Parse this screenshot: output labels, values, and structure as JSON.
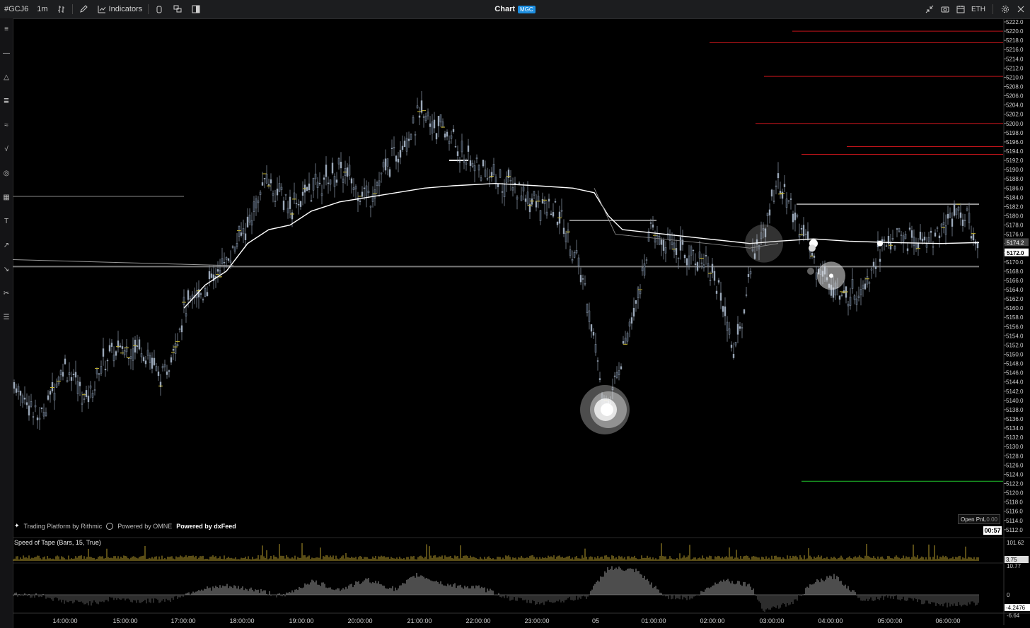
{
  "toolbar": {
    "symbol": "#GCJ6",
    "interval": "1m",
    "indicators_label": "Indicators",
    "title": "Chart",
    "badge": "MGC",
    "session": "ETH"
  },
  "icons": {
    "draw": "pencil-icon",
    "compare": "compare-icon",
    "lock": "lock-icon",
    "layout": "layout-icon",
    "panel": "panel-icon",
    "collapse": "collapse-icon",
    "camera": "camera-icon",
    "calendar": "calendar-icon",
    "settings": "gear-icon",
    "close": "close-icon"
  },
  "sidebar_tools": [
    "menu-icon",
    "line-icon",
    "triangle-icon",
    "fib-icon",
    "pattern-icon",
    "curve-icon",
    "target-icon",
    "grid-icon",
    "text-icon",
    "long-icon",
    "short-icon",
    "ruler-icon",
    "list-icon"
  ],
  "price_axis": {
    "labels": [
      "5222.0",
      "5220.0",
      "5218.0",
      "5216.0",
      "5214.0",
      "5212.0",
      "5210.0",
      "5208.0",
      "5206.0",
      "5204.0",
      "5202.0",
      "5200.0",
      "5198.0",
      "5196.0",
      "5194.0",
      "5192.0",
      "5190.0",
      "5188.0",
      "5186.0",
      "5184.0",
      "5182.0",
      "5180.0",
      "5178.0",
      "5176.0",
      "5174.0",
      "5172.0",
      "5170.0",
      "5168.0",
      "5166.0",
      "5164.0",
      "5162.0",
      "5160.0",
      "5158.0",
      "5156.0",
      "5154.0",
      "5152.0",
      "5150.0",
      "5148.0",
      "5146.0",
      "5144.0",
      "5142.0",
      "5140.0",
      "5138.0",
      "5136.0",
      "5134.0",
      "5132.0",
      "5130.0",
      "5128.0",
      "5126.0",
      "5124.0",
      "5122.0",
      "5120.0",
      "5118.0",
      "5116.0",
      "5114.0",
      "5112.0"
    ],
    "current_price": "5172.0",
    "vwap_price": "5174.2"
  },
  "time_axis": [
    "14:00:00",
    "15:00:00",
    "17:00:00",
    "18:00:00",
    "19:00:00",
    "20:00:00",
    "21:00:00",
    "22:00:00",
    "23:00:00",
    "05",
    "01:00:00",
    "02:00:00",
    "03:00:00",
    "04:00:00",
    "05:00:00",
    "06:00:00"
  ],
  "indicator": {
    "name": "Speed of Tape (Bars, 15, True)",
    "top_axis": [
      "101.62",
      "3.75"
    ],
    "bottom_axis": [
      "10.77",
      "0",
      "-4.2476",
      "-6.64"
    ]
  },
  "credits": {
    "rithmic": "Trading Platform by Rithmic",
    "omne": "Powered by OMNE",
    "dxfeed": "Powered by dxFeed"
  },
  "pnl": {
    "label": "Open PnL",
    "value": "0.00"
  },
  "timer": "00:57",
  "colors": {
    "candle": "#9aa7b8",
    "vwap": "#ffffff",
    "resistance": "#c0141a",
    "support": "#1fbf2a",
    "volume": "#b49a2c"
  }
}
